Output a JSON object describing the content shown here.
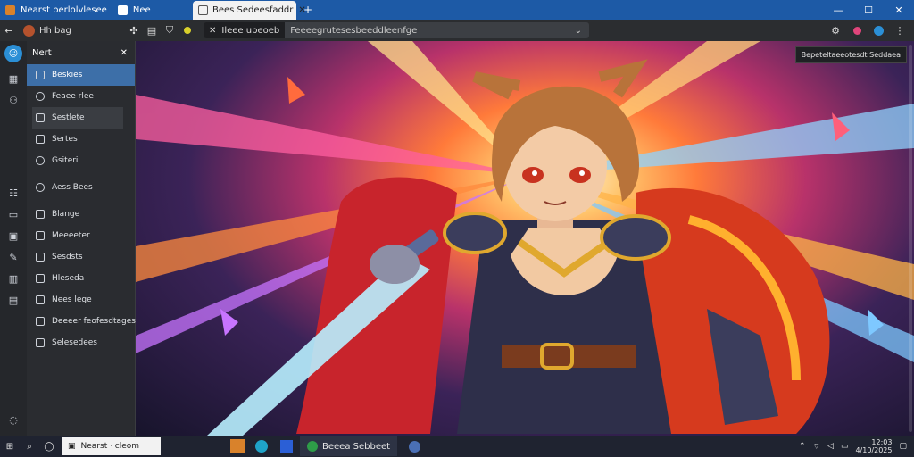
{
  "tabs": [
    {
      "label": "Nearst berlolvlesee",
      "icon": "app-icon"
    },
    {
      "label": "Nee",
      "icon": "tab-icon"
    },
    {
      "label": "Bees Sedeesfaddr",
      "icon": "page-icon",
      "active": true
    }
  ],
  "window": {
    "minimize": "—",
    "maximize": "☐",
    "close": "✕",
    "newtab": "+"
  },
  "toolbar": {
    "profile": "Hh bag",
    "url_prefix": "Ileee upeoeb",
    "url_text": "Feeeegrutesesbeeddleenfge",
    "url_chevron": "⌄"
  },
  "panel": {
    "title": "Nert",
    "items": [
      {
        "label": "Beskies",
        "icon": "folder-icon",
        "selected": true
      },
      {
        "label": "Feaee rlee",
        "icon": "bell-icon"
      },
      {
        "label": "Sestlete",
        "icon": "list-icon",
        "hover": true
      },
      {
        "label": "Sertes",
        "icon": "square-icon"
      },
      {
        "label": "Gsiteri",
        "icon": "circle-icon"
      },
      {
        "label": "Aess Bees",
        "icon": "pin-icon"
      },
      {
        "label": "Blange",
        "icon": "monitor-icon"
      },
      {
        "label": "Meeeeter",
        "icon": "mail-icon"
      },
      {
        "label": "Sesdsts",
        "icon": "doc-icon"
      },
      {
        "label": "Hleseda",
        "icon": "image-icon"
      },
      {
        "label": "Nees lege",
        "icon": "grid-icon"
      },
      {
        "label": "Deeeer feofesdtages",
        "icon": "box-icon"
      },
      {
        "label": "Selesedees",
        "icon": "list-icon"
      }
    ]
  },
  "tooltip": "Bepeteltaeeotesdt Seddaea",
  "taskbar": {
    "search_label": "Nearst ·  cleom",
    "window_label": "Beeea Sebbeet",
    "time": "12:03",
    "date": "4/10/2025"
  }
}
